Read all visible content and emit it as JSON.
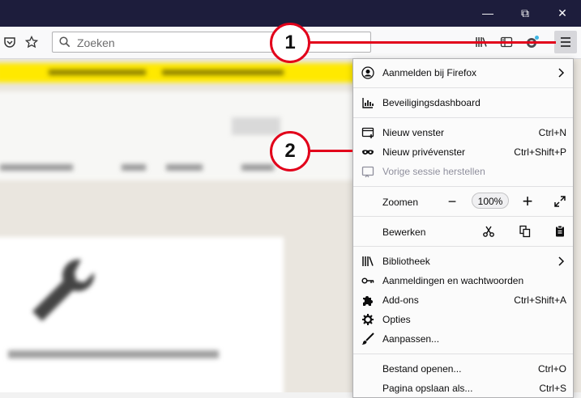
{
  "titlebar": {
    "buttons": [
      {
        "name": "minimize",
        "glyph": "—"
      },
      {
        "name": "restore",
        "glyph": "⧉"
      },
      {
        "name": "close",
        "glyph": "✕"
      }
    ]
  },
  "toolbar": {
    "search_placeholder": "Zoeken"
  },
  "menu": {
    "account": {
      "label": "Aanmelden bij Firefox"
    },
    "security": {
      "label": "Beveiligingsdashboard"
    },
    "new_window": {
      "label": "Nieuw venster",
      "shortcut": "Ctrl+N"
    },
    "new_private": {
      "label": "Nieuw privévenster",
      "shortcut": "Ctrl+Shift+P"
    },
    "restore_session": {
      "label": "Vorige sessie herstellen"
    },
    "zoom": {
      "label": "Zoomen",
      "value": "100%",
      "minus": "−",
      "plus": "+"
    },
    "edit": {
      "label": "Bewerken"
    },
    "library": {
      "label": "Bibliotheek"
    },
    "logins": {
      "label": "Aanmeldingen en wachtwoorden"
    },
    "addons": {
      "label": "Add-ons",
      "shortcut": "Ctrl+Shift+A"
    },
    "options": {
      "label": "Opties"
    },
    "customize": {
      "label": "Aanpassen..."
    },
    "open_file": {
      "label": "Bestand openen...",
      "shortcut": "Ctrl+O"
    },
    "save_page": {
      "label": "Pagina opslaan als...",
      "shortcut": "Ctrl+S"
    }
  },
  "callouts": {
    "one": "1",
    "two": "2"
  },
  "colors": {
    "callout": "#e2001a",
    "titlebar": "#1d1d3c",
    "banner": "#ffe900"
  }
}
